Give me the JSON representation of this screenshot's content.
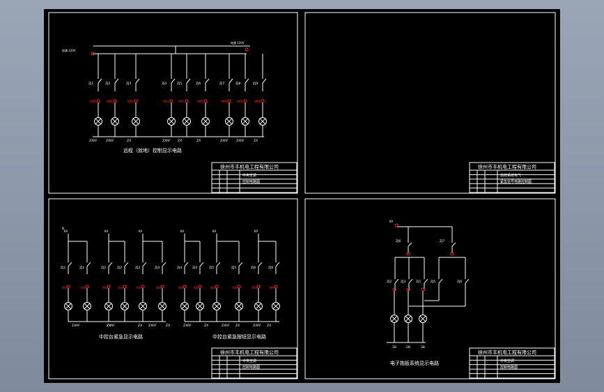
{
  "colors": {
    "background": "#8d99aa",
    "sheet": "#000000",
    "line": "#ffffff",
    "contact": "#ff2020"
  },
  "panel1": {
    "title": "远程（就地）控制显示电路",
    "relays": [
      "ZJ1",
      "ZJ2",
      "ZJ3",
      "ZJ4",
      "ZJ5",
      "ZJ6",
      "ZJ7",
      "ZJ8",
      "ZJ9"
    ],
    "lamp_labels": [
      "ZXRF",
      "ZXRF",
      "ZX",
      "ZXRF",
      "ZX",
      "ZX",
      "ZXRF",
      "ZXRF",
      "ZX"
    ]
  },
  "panel3": {
    "left_title": "中控台紧急显示电路",
    "right_title": "中控台紧急按钮显示电路",
    "relays": [
      "ZJ1",
      "ZJ2",
      "ZJ3",
      "ZJ4",
      "ZJ5",
      "ZJ6"
    ]
  },
  "panel4": {
    "title": "电子抱扳系统显示电路",
    "relays": [
      "ZJ6",
      "ZJ7",
      "ZJ2",
      "ZJ3",
      "ZJ1",
      "ZJ5"
    ],
    "bottom_labels": [
      "1B",
      "2B",
      "3B"
    ]
  },
  "title_block": {
    "company": "徐州市丰机电工程有限公司",
    "project": "中央空调",
    "drawing": "控制电路图",
    "drawing_alt": "紧急信号电路控制图",
    "project_alt": "自控系统电气"
  }
}
